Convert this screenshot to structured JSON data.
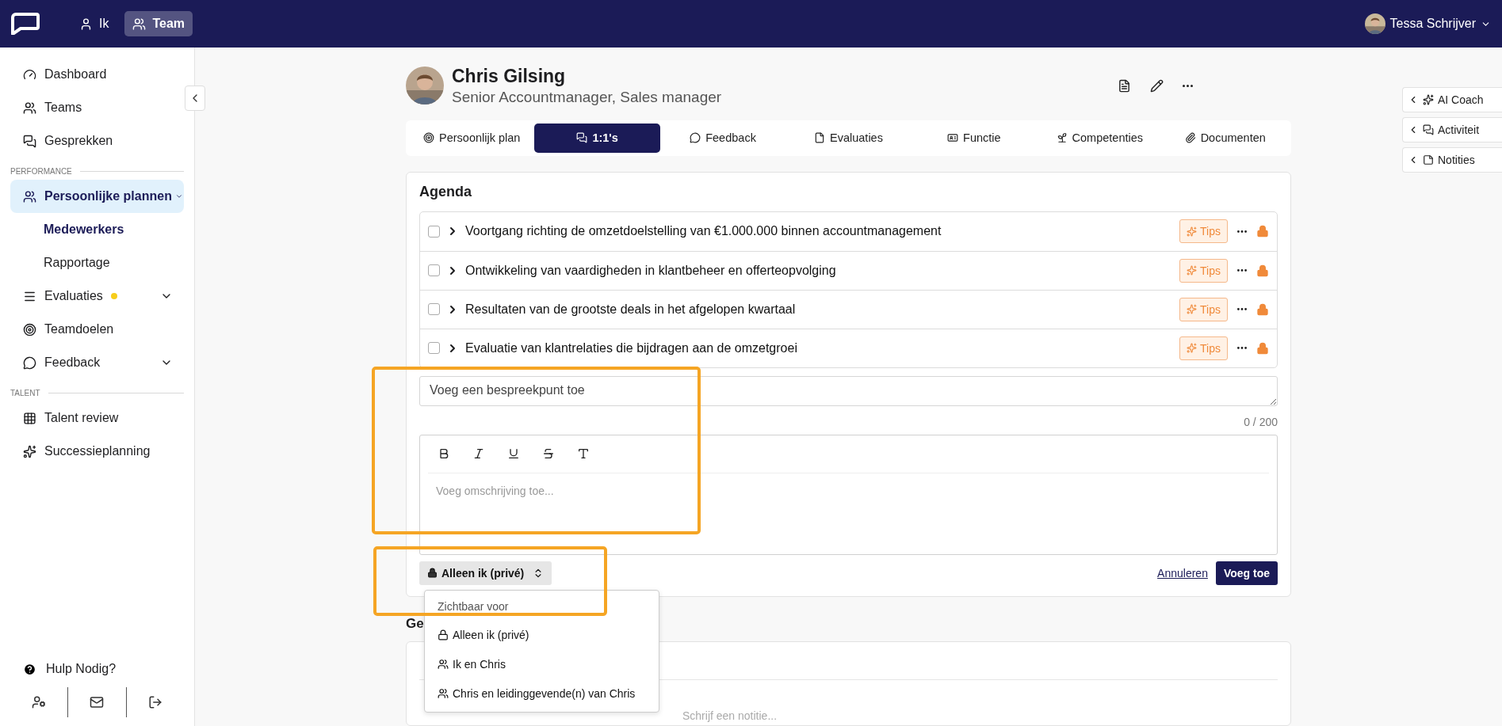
{
  "topbar": {
    "nav": [
      {
        "label": "Ik",
        "selected": false
      },
      {
        "label": "Team",
        "selected": true
      }
    ],
    "user": {
      "name": "Tessa Schrijver"
    }
  },
  "sidebar": {
    "items": [
      {
        "kind": "item",
        "label": "Dashboard",
        "selected": false
      },
      {
        "kind": "item",
        "label": "Teams",
        "selected": false
      },
      {
        "kind": "item",
        "label": "Gesprekken",
        "selected": false
      },
      {
        "kind": "section",
        "label": "PERFORMANCE"
      },
      {
        "kind": "item",
        "label": "Persoonlijke plannen",
        "selected": true,
        "expandable": true
      },
      {
        "kind": "subitem",
        "label": "Medewerkers",
        "selected": true
      },
      {
        "kind": "subitem",
        "label": "Rapportage",
        "selected": false
      },
      {
        "kind": "item",
        "label": "Evaluaties",
        "selected": false,
        "expandable": true,
        "color": "#f7cd1b"
      },
      {
        "kind": "item",
        "label": "Teamdoelen",
        "selected": false
      },
      {
        "kind": "item",
        "label": "Feedback",
        "selected": false,
        "expandable": true
      },
      {
        "kind": "section",
        "label": "TALENT"
      },
      {
        "kind": "item",
        "label": "Talent review",
        "selected": false
      },
      {
        "kind": "item",
        "label": "Successieplanning",
        "selected": false
      }
    ],
    "help": "Hulp Nodig?"
  },
  "profile": {
    "name": "Chris Gilsing",
    "role": "Senior Accountmanager, Sales manager"
  },
  "tabs": [
    {
      "label": "Persoonlijk plan",
      "selected": false
    },
    {
      "label": "1:1's",
      "selected": true
    },
    {
      "label": "Feedback",
      "selected": false
    },
    {
      "label": "Evaluaties",
      "selected": false
    },
    {
      "label": "Functie",
      "selected": false
    },
    {
      "label": "Competenties",
      "selected": false
    },
    {
      "label": "Documenten",
      "selected": false
    }
  ],
  "agenda": {
    "title": "Agenda",
    "items": [
      {
        "title": "Voortgang richting de omzetdoelstelling van €1.000.000 binnen accountmanagement",
        "checked": false,
        "tips": "Tips"
      },
      {
        "title": "Ontwikkeling van vaardigheden in klantbeheer en offerteopvolging",
        "checked": false,
        "tips": "Tips"
      },
      {
        "title": "Resultaten van de grootste deals in het afgelopen kwartaal",
        "checked": false,
        "tips": "Tips"
      },
      {
        "title": "Evaluatie van klantrelaties die bijdragen aan de omzetgroei",
        "checked": false,
        "tips": "Tips"
      }
    ],
    "new_item": {
      "placeholder": "Voeg een bespreekpunt toe",
      "counter": "0 / 200",
      "description_placeholder": "Voeg omschrijving toe...",
      "visibility": "Alleen ik (privé)",
      "cancel": "Annuleren",
      "submit": "Voeg toe"
    }
  },
  "visibility_menu": {
    "header": "Zichtbaar voor",
    "options": [
      {
        "label": "Alleen ik (privé)"
      },
      {
        "label": "Ik en Chris"
      },
      {
        "label": "Chris en leidinggevende(n) van Chris"
      }
    ]
  },
  "notes": {
    "heading": "Ge",
    "placeholder": "Schrijf een notitie..."
  },
  "side_panels": [
    {
      "label": "AI Coach"
    },
    {
      "label": "Activiteit"
    },
    {
      "label": "Notities"
    }
  ]
}
